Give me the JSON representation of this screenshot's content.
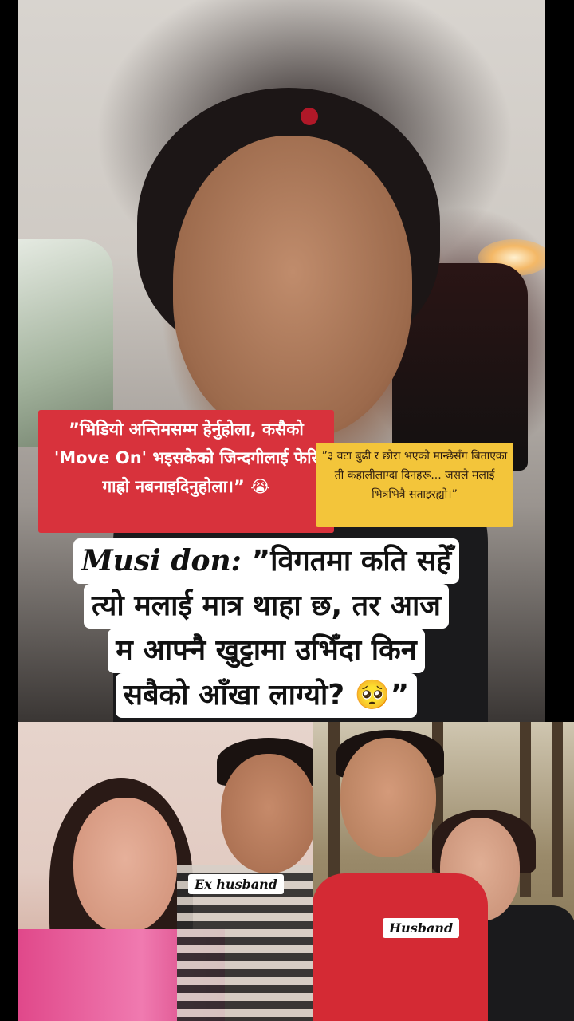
{
  "captions": {
    "quote_red": "”भिडियो अन्तिमसम्म हेर्नुहोला, कसैको 'Move On' भइसकेको जिन्दगीलाई फेरि गाह्रो नबनाइदिनुहोला।” 😭",
    "quote_yellow": "”३ वटा बुढी र छोरा भएको मान्छेसँग बिताएका ती कहालीलाग्दा दिनहरू... जसले मलाई भित्रभित्रै सताइरह्यो।”"
  },
  "headline": {
    "brand": "Musi don:",
    "line1_rest": " ”विगतमा कति सहेँ",
    "line2": "त्यो मलाई मात्र थाहा छ, तर आज",
    "line3": "म आफ्नै खुट्टामा उभिँदा किन",
    "line4": "सबैको आँखा लाग्यो? 🥺”"
  },
  "labels": {
    "ex_husband": "Ex husband",
    "husband": "Husband"
  }
}
